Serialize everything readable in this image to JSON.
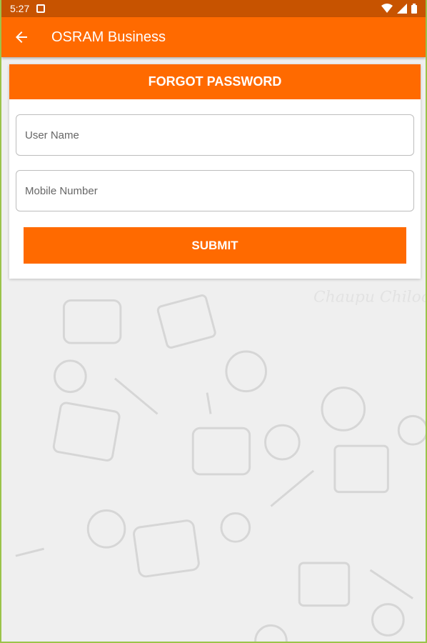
{
  "status_bar": {
    "time": "5:27"
  },
  "app_bar": {
    "title": "OSRAM Business"
  },
  "card": {
    "header": "FORGOT PASSWORD",
    "username_placeholder": "User Name",
    "mobile_placeholder": "Mobile Number",
    "submit_label": "SUBMIT"
  },
  "background": {
    "watermark": "Chaupu Chiloo"
  },
  "colors": {
    "accent": "#ff6a00",
    "status_bar": "#c75300",
    "border": "#9bc34a"
  }
}
